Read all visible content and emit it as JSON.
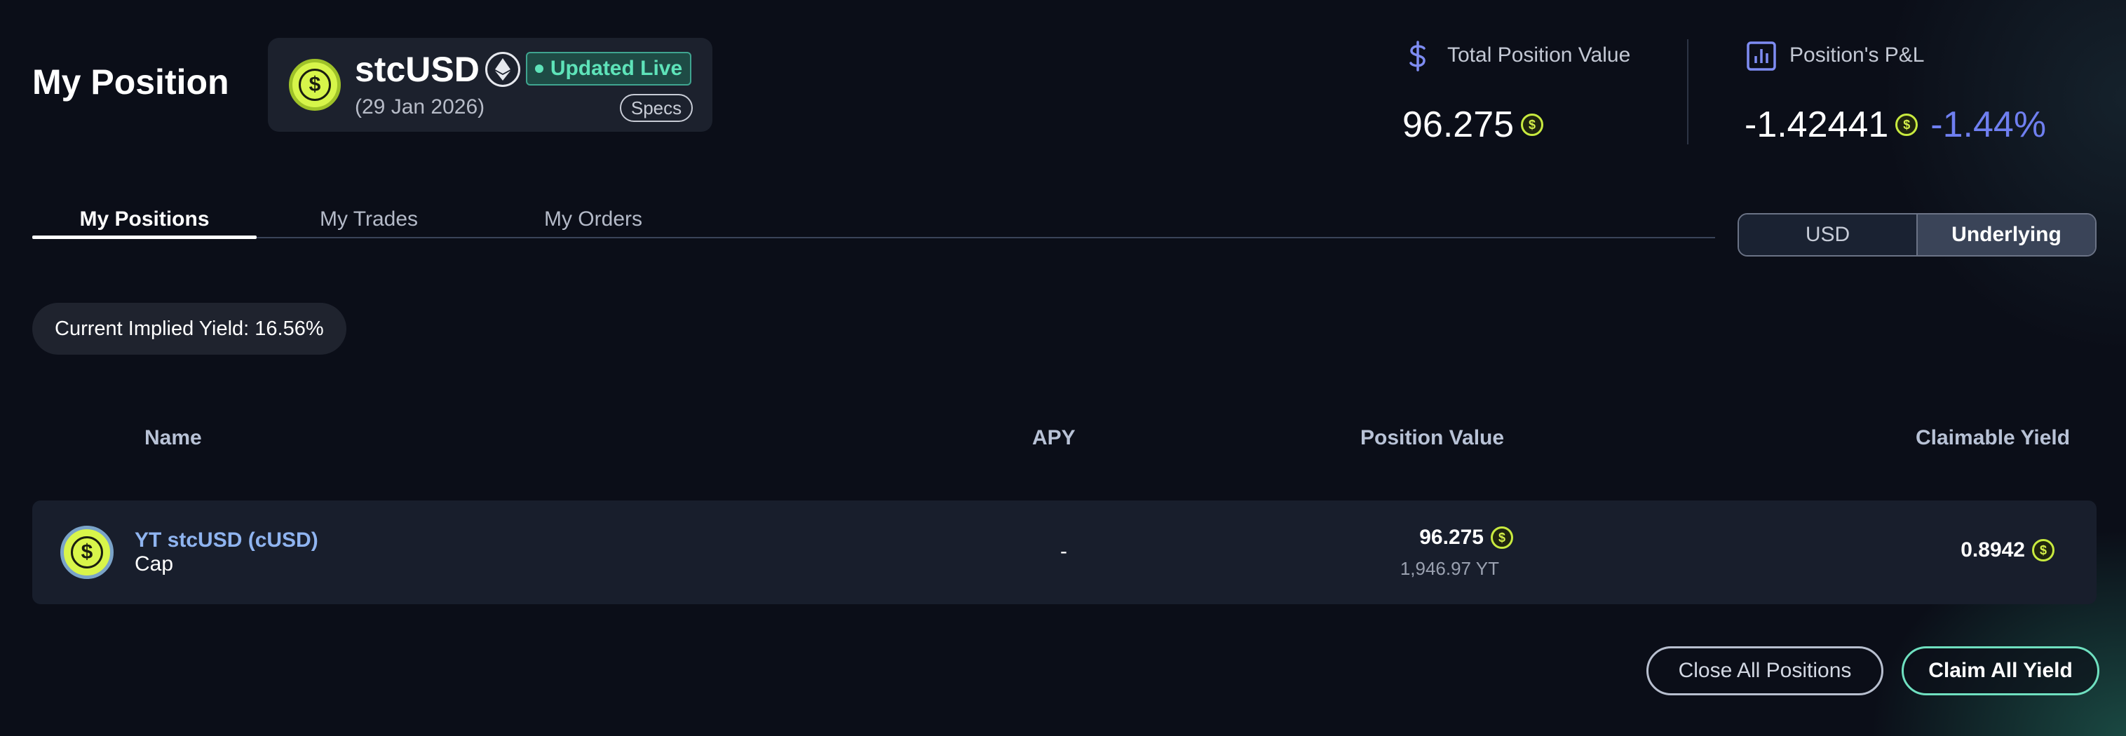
{
  "page_title": "My Position",
  "market": {
    "symbol": "stcUSD",
    "live_badge": "Updated Live",
    "maturity": "(29 Jan 2026)",
    "specs_label": "Specs"
  },
  "stats": {
    "total_value_label": "Total Position Value",
    "total_value": "96.275",
    "pnl_label": "Position's P&L",
    "pnl_value": "-1.42441",
    "pnl_percent": "-1.44%"
  },
  "tabs": [
    {
      "label": "My Positions",
      "active": true
    },
    {
      "label": "My Trades",
      "active": false
    },
    {
      "label": "My Orders",
      "active": false
    }
  ],
  "currency_toggle": {
    "options": [
      "USD",
      "Underlying"
    ],
    "selected": "Underlying"
  },
  "implied_yield": "Current Implied Yield: 16.56%",
  "table": {
    "headers": [
      "Name",
      "APY",
      "Position Value",
      "Claimable Yield"
    ],
    "rows": [
      {
        "name": "YT stcUSD (cUSD)",
        "protocol": "Cap",
        "apy": "-",
        "position_value": "96.275",
        "position_amount": "1,946.97 YT",
        "claimable_yield": "0.8942"
      }
    ]
  },
  "actions": {
    "close_all": "Close All Positions",
    "claim_all": "Claim All Yield"
  },
  "colors": {
    "background": "#0b0e18",
    "accent_blue": "#6f7ff0",
    "live_green": "#5ee3b9",
    "coin_yellow": "#d7f54a"
  },
  "icons": [
    "stcusd-coin-icon",
    "ethereum-icon",
    "dollar-sign-icon",
    "bar-chart-icon",
    "dollar-coin-icon"
  ]
}
